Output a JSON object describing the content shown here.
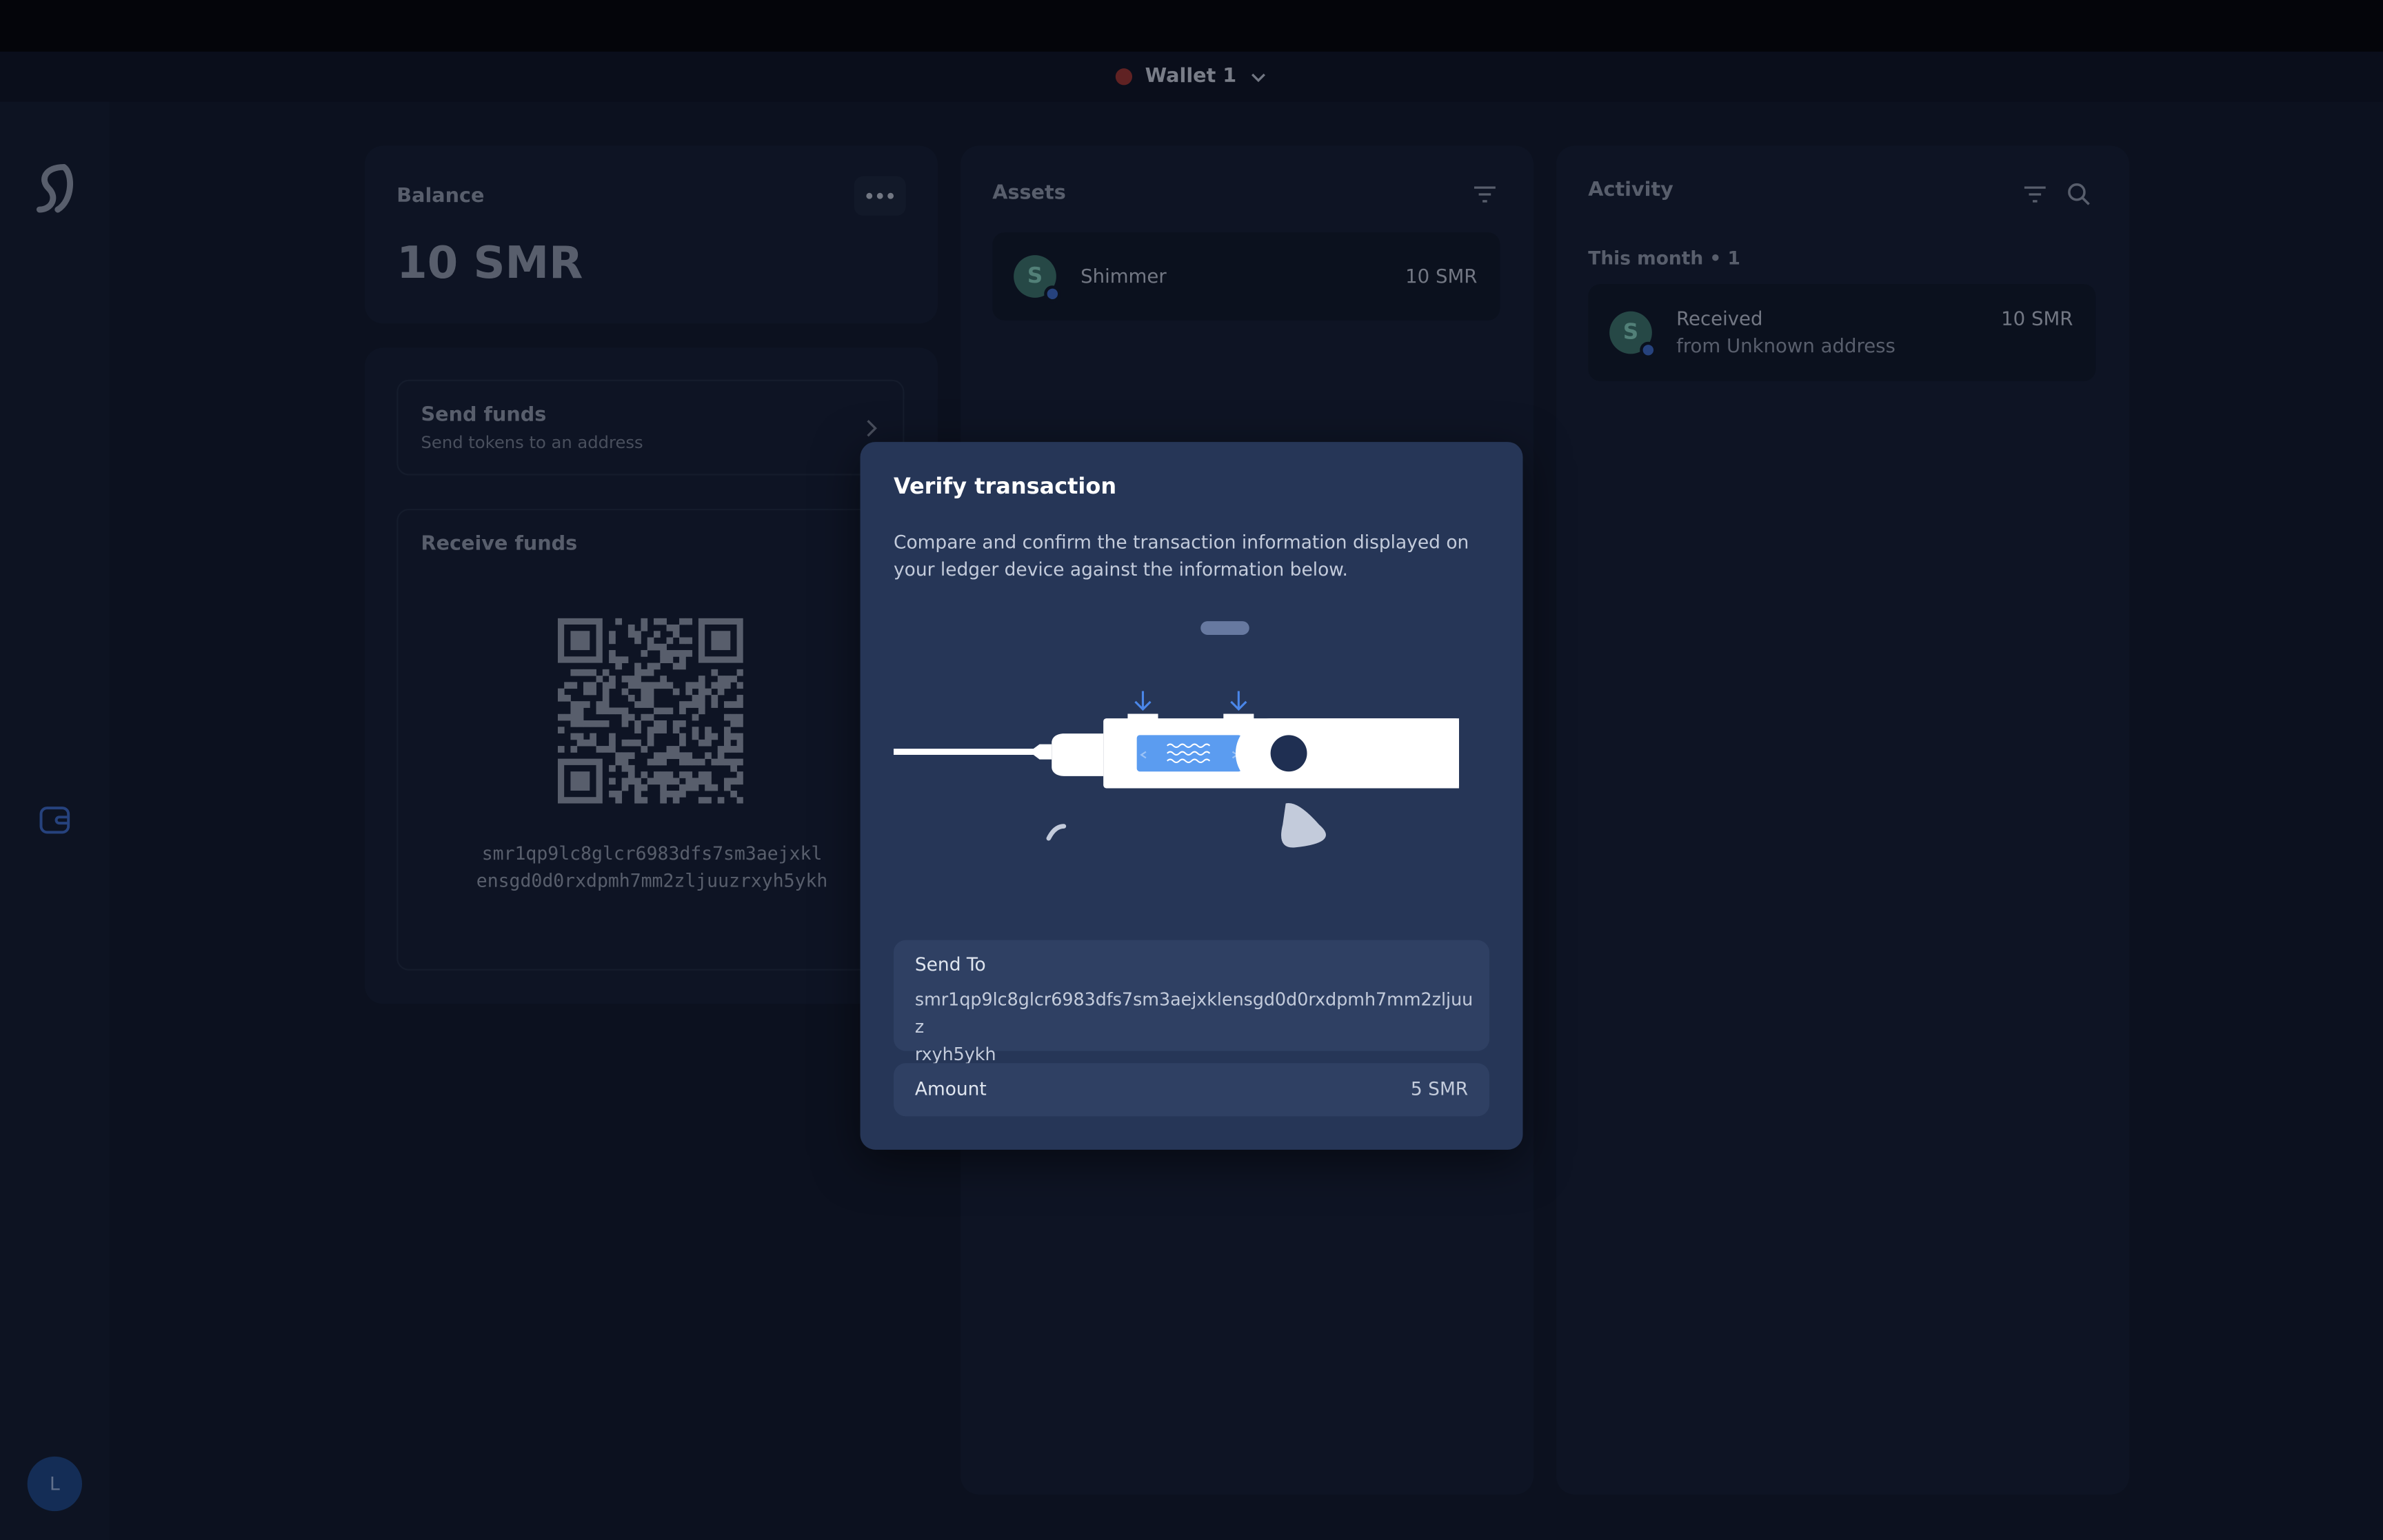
{
  "wallet": {
    "name": "Wallet 1",
    "status_color": "#a8362f"
  },
  "sidebar": {
    "avatar_initial": "L"
  },
  "balance": {
    "title": "Balance",
    "amount": "10 SMR"
  },
  "send": {
    "title": "Send funds",
    "subtitle": "Send tokens to an address"
  },
  "receive": {
    "title": "Receive funds",
    "address_line1": "smr1qp9lc8glcr6983dfs7sm3aejxkl",
    "address_line2": "ensgd0d0rxdpmh7mm2zljuuzrxyh5ykh"
  },
  "assets": {
    "title": "Assets",
    "items": [
      {
        "name": "Shimmer",
        "amount": "10 SMR"
      }
    ]
  },
  "activity": {
    "title": "Activity",
    "group_label": "This month • 1",
    "items": [
      {
        "title": "Received",
        "subtitle": "from Unknown address",
        "amount": "10 SMR"
      }
    ]
  },
  "modal": {
    "title": "Verify transaction",
    "description": "Compare and confirm the transaction information displayed on your ledger device against the information below.",
    "send_to_label": "Send To",
    "send_to_line1": "smr1qp9lc8glcr6983dfs7sm3aejxklensgd0d0rxdpmh7mm2zljuuz",
    "send_to_line2": "rxyh5ykh",
    "amount_label": "Amount",
    "amount_value": "5 SMR"
  },
  "colors": {
    "accent": "#3e6fd1",
    "token": "#3f7a6e",
    "modal_bg": "#263657"
  }
}
